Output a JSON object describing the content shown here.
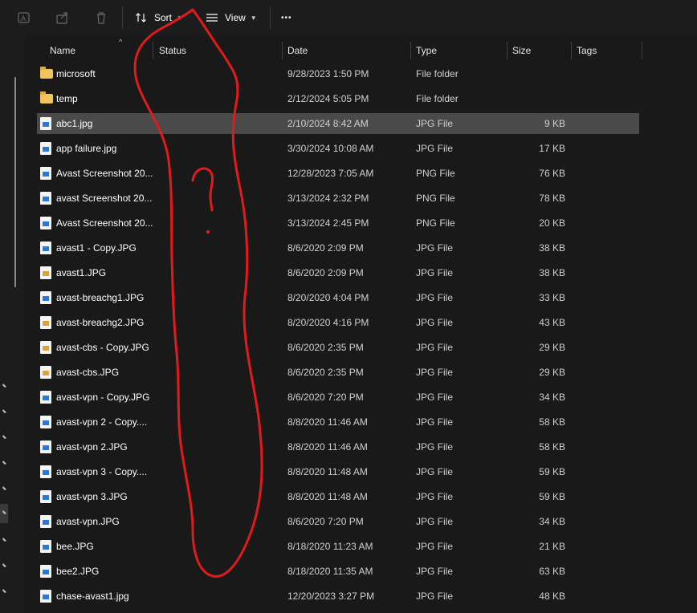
{
  "toolbar": {
    "sort_label": "Sort",
    "view_label": "View",
    "more_label": "•••"
  },
  "columns": {
    "name": "Name",
    "status": "Status",
    "date": "Date",
    "type": "Type",
    "size": "Size",
    "tags": "Tags"
  },
  "files": [
    {
      "name": "microsoft",
      "date": "9/28/2023 1:50 PM",
      "type": "File folder",
      "size": "",
      "icon": "folder-icon"
    },
    {
      "name": "temp",
      "date": "2/12/2024 5:05 PM",
      "type": "File folder",
      "size": "",
      "icon": "folder-icon"
    },
    {
      "name": "abc1.jpg",
      "date": "2/10/2024 8:42 AM",
      "type": "JPG File",
      "size": "9 KB",
      "icon": "image-file-icon",
      "selected": true
    },
    {
      "name": "app failure.jpg",
      "date": "3/30/2024 10:08 AM",
      "type": "JPG File",
      "size": "17 KB",
      "icon": "image-file-icon"
    },
    {
      "name": "Avast Screenshot 20...",
      "date": "12/28/2023 7:05 AM",
      "type": "PNG File",
      "size": "76 KB",
      "icon": "image-file-icon"
    },
    {
      "name": "avast Screenshot 20...",
      "date": "3/13/2024 2:32 PM",
      "type": "PNG File",
      "size": "78 KB",
      "icon": "image-file-icon"
    },
    {
      "name": "Avast Screenshot 20...",
      "date": "3/13/2024 2:45 PM",
      "type": "PNG File",
      "size": "20 KB",
      "icon": "image-file-icon"
    },
    {
      "name": "avast1 - Copy.JPG",
      "date": "8/6/2020 2:09 PM",
      "type": "JPG File",
      "size": "38 KB",
      "icon": "image-file-icon"
    },
    {
      "name": "avast1.JPG",
      "date": "8/6/2020 2:09 PM",
      "type": "JPG File",
      "size": "38 KB",
      "icon": "image-file-icon-alt"
    },
    {
      "name": "avast-breachg1.JPG",
      "date": "8/20/2020 4:04 PM",
      "type": "JPG File",
      "size": "33 KB",
      "icon": "image-file-icon"
    },
    {
      "name": "avast-breachg2.JPG",
      "date": "8/20/2020 4:16 PM",
      "type": "JPG File",
      "size": "43 KB",
      "icon": "image-file-icon-alt"
    },
    {
      "name": "avast-cbs - Copy.JPG",
      "date": "8/6/2020 2:35 PM",
      "type": "JPG File",
      "size": "29 KB",
      "icon": "image-file-icon-alt"
    },
    {
      "name": "avast-cbs.JPG",
      "date": "8/6/2020 2:35 PM",
      "type": "JPG File",
      "size": "29 KB",
      "icon": "image-file-icon-alt"
    },
    {
      "name": "avast-vpn - Copy.JPG",
      "date": "8/6/2020 7:20 PM",
      "type": "JPG File",
      "size": "34 KB",
      "icon": "image-file-icon"
    },
    {
      "name": "avast-vpn 2 - Copy....",
      "date": "8/8/2020 11:46 AM",
      "type": "JPG File",
      "size": "58 KB",
      "icon": "image-file-icon"
    },
    {
      "name": "avast-vpn 2.JPG",
      "date": "8/8/2020 11:46 AM",
      "type": "JPG File",
      "size": "58 KB",
      "icon": "image-file-icon"
    },
    {
      "name": "avast-vpn 3 - Copy....",
      "date": "8/8/2020 11:48 AM",
      "type": "JPG File",
      "size": "59 KB",
      "icon": "image-file-icon"
    },
    {
      "name": "avast-vpn 3.JPG",
      "date": "8/8/2020 11:48 AM",
      "type": "JPG File",
      "size": "59 KB",
      "icon": "image-file-icon"
    },
    {
      "name": "avast-vpn.JPG",
      "date": "8/6/2020 7:20 PM",
      "type": "JPG File",
      "size": "34 KB",
      "icon": "image-file-icon"
    },
    {
      "name": "bee.JPG",
      "date": "8/18/2020 11:23 AM",
      "type": "JPG File",
      "size": "21 KB",
      "icon": "image-file-icon"
    },
    {
      "name": "bee2.JPG",
      "date": "8/18/2020 11:35 AM",
      "type": "JPG File",
      "size": "63 KB",
      "icon": "image-file-icon"
    },
    {
      "name": "chase-avast1.jpg",
      "date": "12/20/2023 3:27 PM",
      "type": "JPG File",
      "size": "48 KB",
      "icon": "image-file-icon"
    }
  ],
  "annotation": {
    "color": "#e01b1b",
    "glyph": "?"
  }
}
